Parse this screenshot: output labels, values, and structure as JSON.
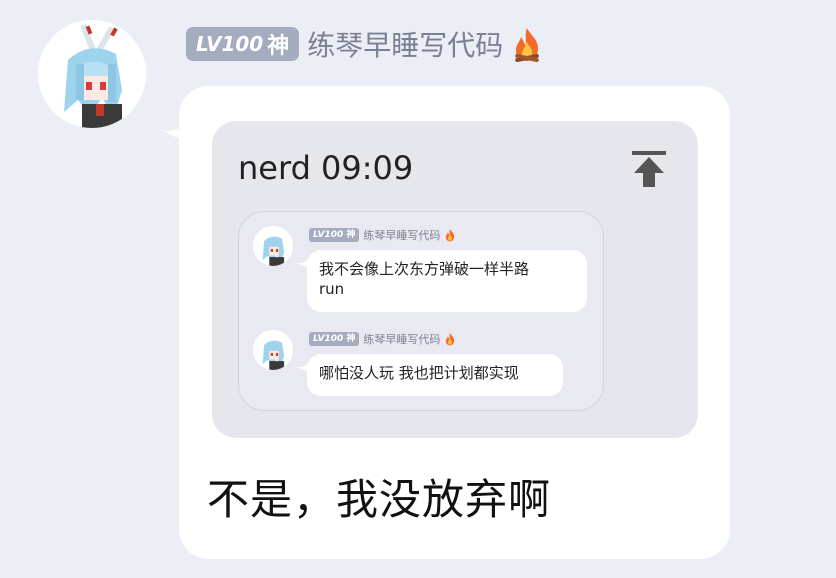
{
  "sender": {
    "level_prefix": "LV100",
    "level_title": "神",
    "name": "练琴早睡写代码",
    "name_icon": "fire-icon",
    "avatar": "pixel-bunny-avatar"
  },
  "message": {
    "forward_card": {
      "title": "nerd 09:09",
      "pin_icon": "pin-top-icon",
      "quoted_messages": [
        {
          "level_prefix": "LV100",
          "level_title": "神",
          "name": "练琴早睡写代码",
          "line1": "我不会像上次东方弹破一样半路",
          "line2": "run"
        },
        {
          "level_prefix": "LV100",
          "level_title": "神",
          "name": "练琴早睡写代码",
          "line1": "哪怕没人玩 我也把计划都实现"
        }
      ]
    },
    "text": "不是，我没放弃啊"
  },
  "colors": {
    "background": "#eceef5",
    "bubble": "#ffffff",
    "card": "#e6e7ec",
    "badge": "#a5acc0",
    "name": "#7b8195"
  }
}
